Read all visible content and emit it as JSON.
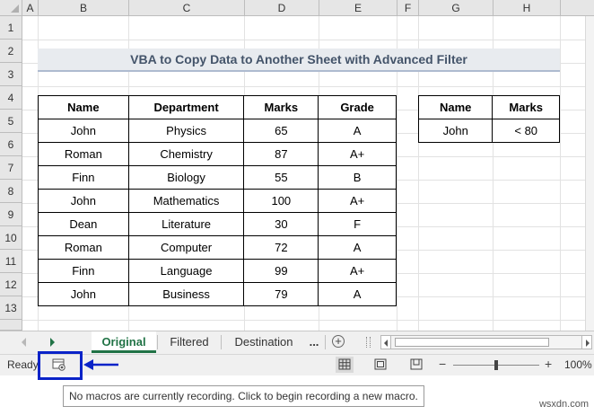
{
  "spreadsheet": {
    "columns": [
      "A",
      "B",
      "C",
      "D",
      "E",
      "F",
      "G",
      "H"
    ],
    "rows": [
      "1",
      "2",
      "3",
      "4",
      "5",
      "6",
      "7",
      "8",
      "9",
      "10",
      "11",
      "12",
      "13"
    ],
    "title": "VBA to Copy Data to Another Sheet with Advanced Filter",
    "main_table": {
      "headers": [
        "Name",
        "Department",
        "Marks",
        "Grade"
      ],
      "rows": [
        [
          "John",
          "Physics",
          "65",
          "A"
        ],
        [
          "Roman",
          "Chemistry",
          "87",
          "A+"
        ],
        [
          "Finn",
          "Biology",
          "55",
          "B"
        ],
        [
          "John",
          "Mathematics",
          "100",
          "A+"
        ],
        [
          "Dean",
          "Literature",
          "30",
          "F"
        ],
        [
          "Roman",
          "Computer",
          "72",
          "A"
        ],
        [
          "Finn",
          "Language",
          "99",
          "A+"
        ],
        [
          "John",
          "Business",
          "79",
          "A"
        ]
      ]
    },
    "criteria_table": {
      "headers": [
        "Name",
        "Marks"
      ],
      "rows": [
        [
          "John",
          "< 80"
        ]
      ]
    }
  },
  "sheet_tabs": {
    "tabs": [
      "Original",
      "Filtered",
      "Destination"
    ],
    "active": "Original",
    "more": "...",
    "add": "+"
  },
  "status_bar": {
    "status": "Ready",
    "zoom": "100%",
    "zoom_level": 1.0
  },
  "tooltip": "No macros are currently recording. Click to begin recording a new macro.",
  "watermark": "wsxdn.com",
  "colors": {
    "accent": "#217346",
    "highlight_box": "#0a23c8",
    "title_text": "#44546a",
    "title_fill": "#e8ebef"
  }
}
